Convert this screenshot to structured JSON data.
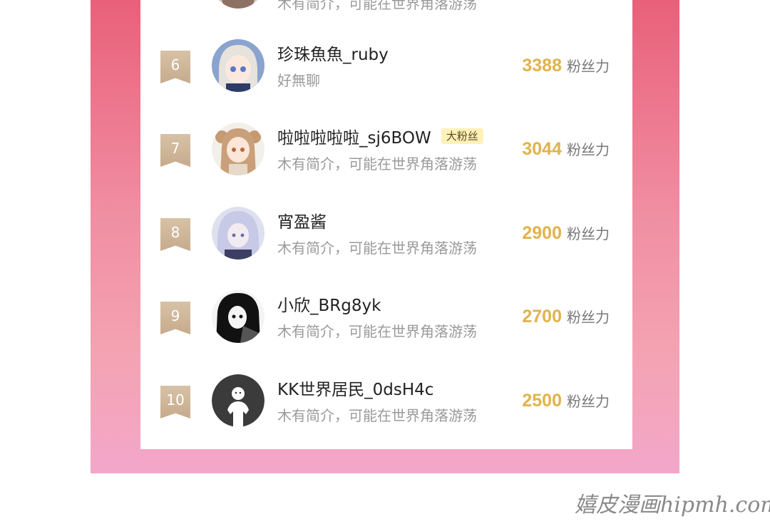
{
  "ranking": {
    "partial_top_bio": "木有简介，可能在世界角落游荡",
    "entries": [
      {
        "rank": "6",
        "name": "珍珠魚魚_ruby",
        "badge": "",
        "bio": "好無聊",
        "score": "3388",
        "unit": "粉丝力",
        "avatar": "anime-girl-silver-hair-avatar"
      },
      {
        "rank": "7",
        "name": "啦啦啦啦啦_sj6BOW",
        "badge": "大粉丝",
        "bio": "木有简介，可能在世界角落游荡",
        "score": "3044",
        "unit": "粉丝力",
        "avatar": "anime-girl-twin-tails-avatar"
      },
      {
        "rank": "8",
        "name": "宵盈酱",
        "badge": "",
        "bio": "木有简介，可能在世界角落游荡",
        "score": "2900",
        "unit": "粉丝力",
        "avatar": "anime-white-hair-avatar"
      },
      {
        "rank": "9",
        "name": "小欣_BRg8yk",
        "badge": "",
        "bio": "木有简介，可能在世界角落游荡",
        "score": "2700",
        "unit": "粉丝力",
        "avatar": "manga-black-hair-girl-avatar"
      },
      {
        "rank": "10",
        "name": "KK世界居民_0dsH4c",
        "badge": "",
        "bio": "木有简介，可能在世界角落游荡",
        "score": "2500",
        "unit": "粉丝力",
        "avatar": "default-user-avatar"
      }
    ]
  },
  "watermark": "嬉皮漫画hipmh.com",
  "colors": {
    "frame_top": "#e9607a",
    "frame_bottom": "#f3a7c9",
    "score": "#e0b34b",
    "rank_badge": "#cbb193",
    "fan_tag_bg": "#fff2b8"
  }
}
